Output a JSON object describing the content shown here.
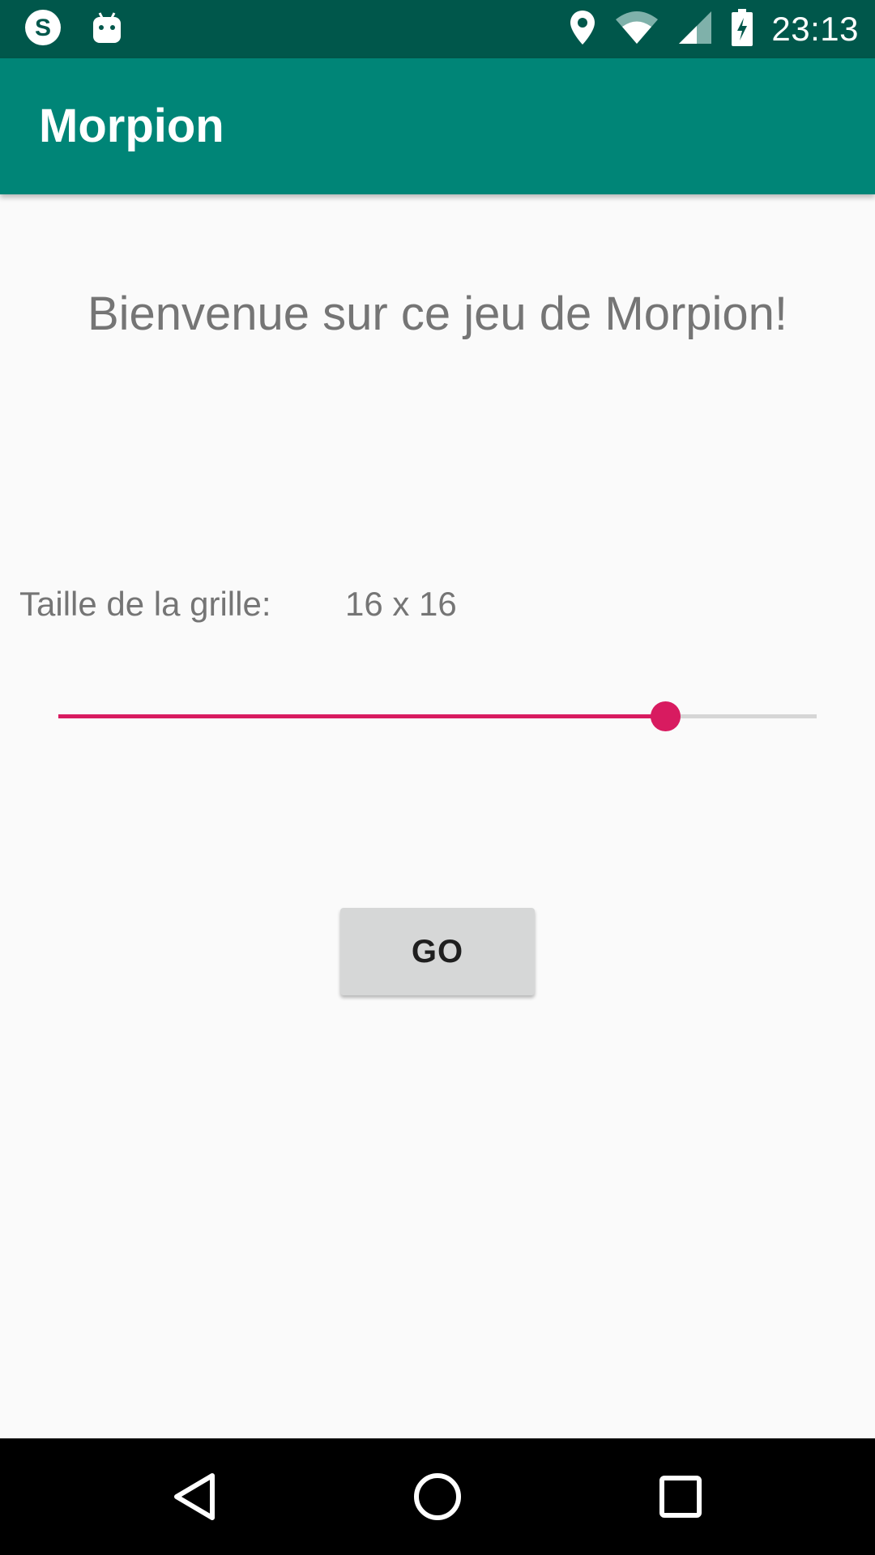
{
  "status_bar": {
    "time": "23:13",
    "icons": [
      "skype-icon",
      "android-icon",
      "location-icon",
      "wifi-icon",
      "cell-signal-icon",
      "battery-charging-icon"
    ]
  },
  "app_bar": {
    "title": "Morpion"
  },
  "main": {
    "welcome": "Bienvenue sur ce jeu de Morpion!",
    "grid_size_label": "Taille de la grille:",
    "grid_size_value": "16 x 16",
    "slider": {
      "fraction": 0.8
    },
    "go_label": "GO"
  },
  "colors": {
    "status_bar": "#00574b",
    "app_bar": "#008577",
    "accent": "#d81b60",
    "background": "#fafafa",
    "text_secondary": "#757575"
  },
  "nav_bar": {
    "icons": [
      "back-icon",
      "home-icon",
      "recents-icon"
    ]
  }
}
